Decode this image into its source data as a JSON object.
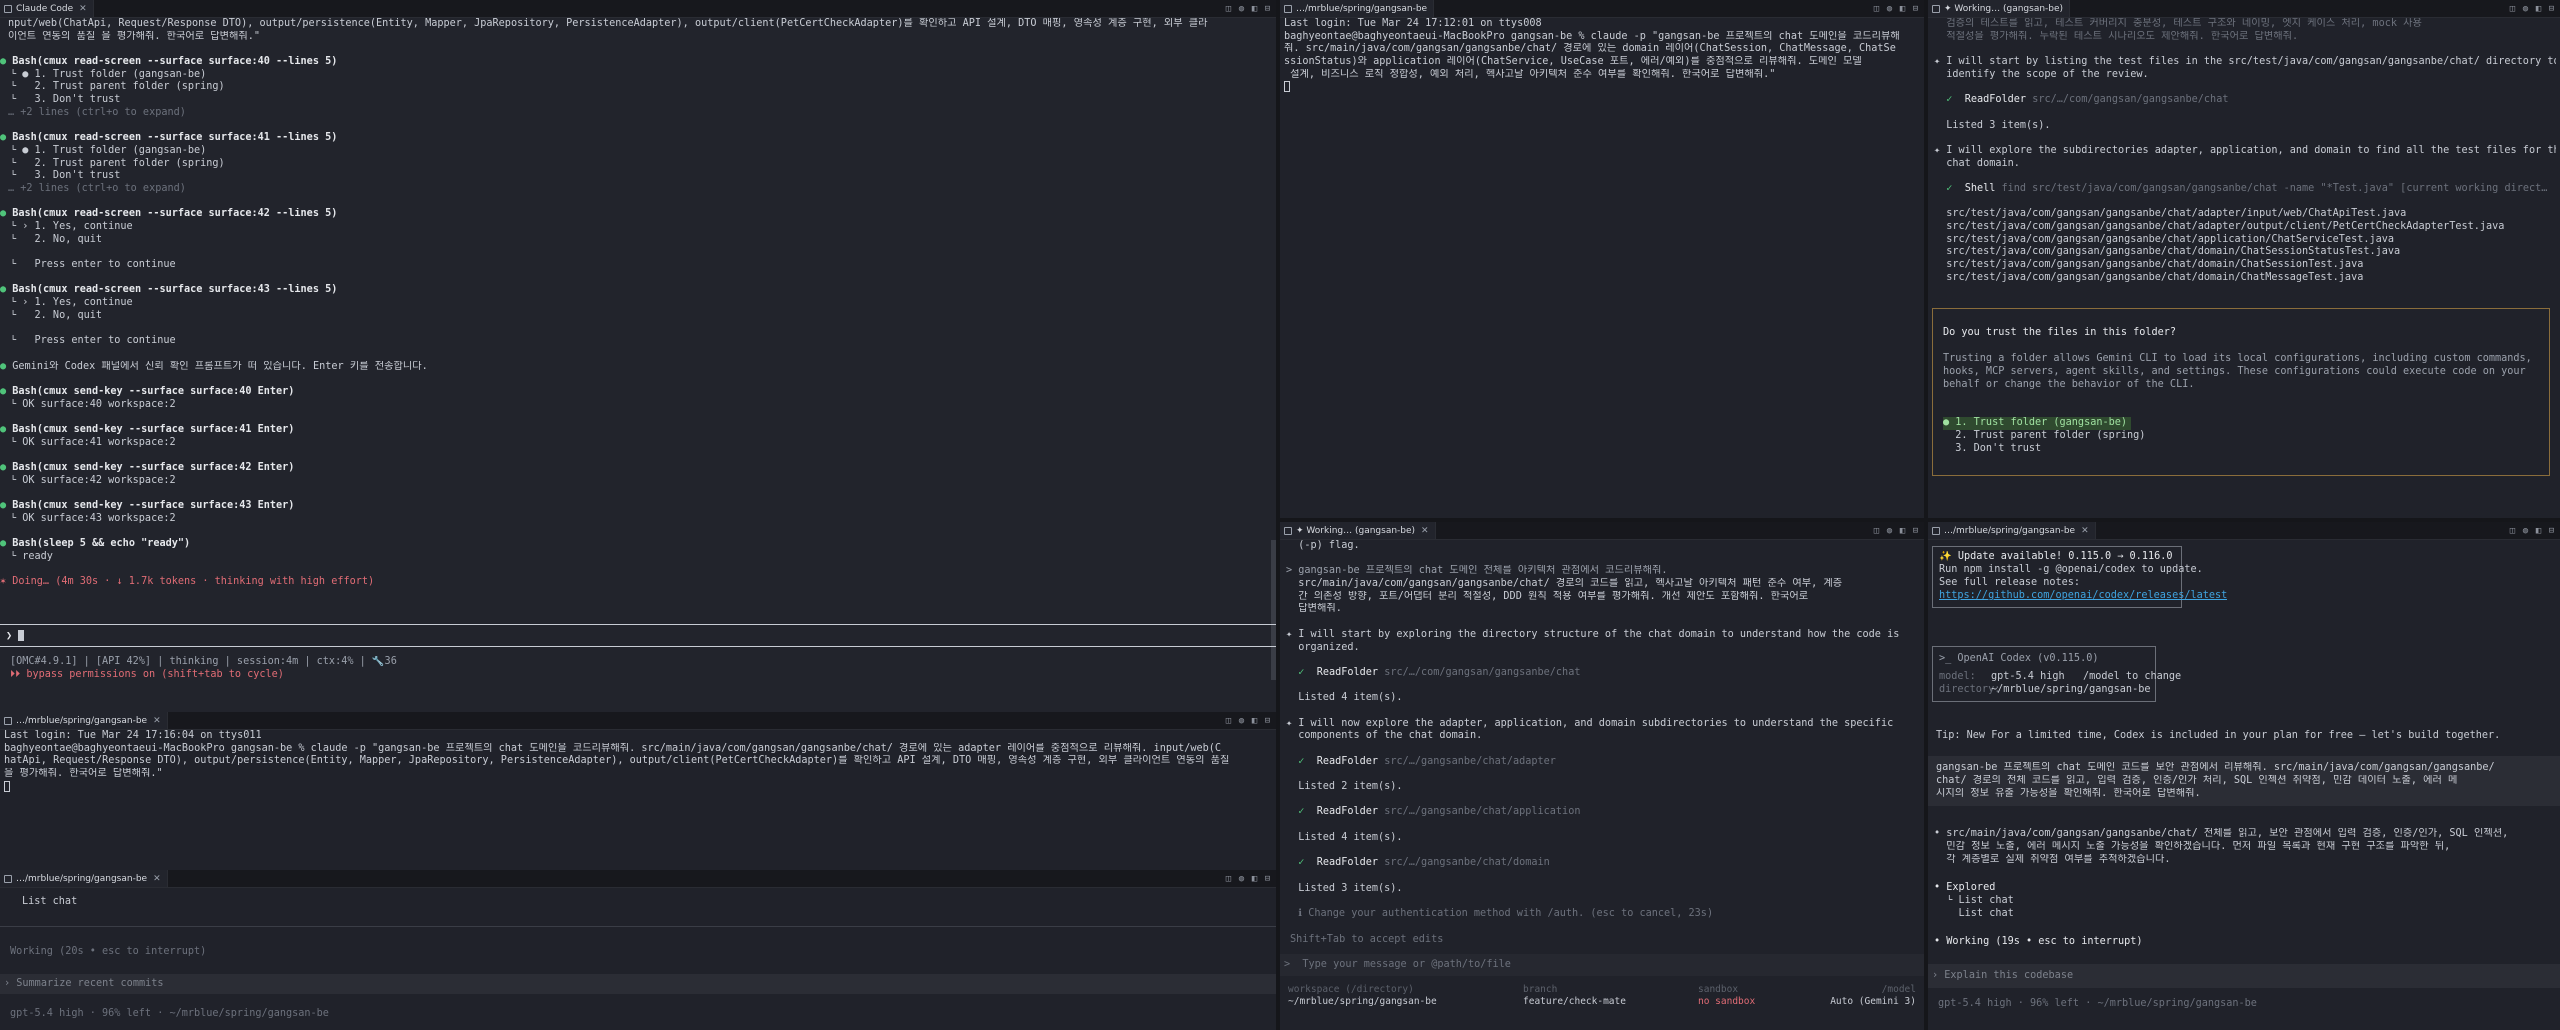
{
  "pane_tl": {
    "tab": "Claude Code",
    "lines": [
      "nput/web(ChatApi, Request/Response DTO), output/persistence(Entity, Mapper, JpaRepository, PersistenceAdapter), output/client(PetCertCheckAdapter)를 확인하고 API 설계, DTO 매핑, 영속성 계층 구현, 외부 클라",
      "이언트 연동의 품질 을 평가해줘. 한국어로 답변해줘.\"",
      "",
      "Bash(cmux read-screen --surface surface:40 --lines 5)",
      "  ● 1. Trust folder (gangsan-be)",
      "    2. Trust parent folder (spring)",
      "    3. Don't trust",
      "… +2 lines (ctrl+o to expand)",
      "",
      "Bash(cmux read-screen --surface surface:41 --lines 5)",
      "  ● 1. Trust folder (gangsan-be)",
      "    2. Trust parent folder (spring)",
      "    3. Don't trust",
      "… +2 lines (ctrl+o to expand)",
      "",
      "Bash(cmux read-screen --surface surface:42 --lines 5)",
      "  › 1. Yes, continue",
      "    2. No, quit",
      "",
      "    Press enter to continue",
      "",
      "Bash(cmux read-screen --surface surface:43 --lines 5)",
      "  › 1. Yes, continue",
      "    2. No, quit",
      "",
      "    Press enter to continue",
      "",
      "Gemini와 Codex 패널에서 신뢰 확인 프롬프트가 떠 있습니다. Enter 키를 전송합니다.",
      "",
      "Bash(cmux send-key --surface surface:40 Enter)",
      "  OK surface:40 workspace:2",
      "",
      "Bash(cmux send-key --surface surface:41 Enter)",
      "  OK surface:41 workspace:2",
      "",
      "Bash(cmux send-key --surface surface:42 Enter)",
      "  OK surface:42 workspace:2",
      "",
      "Bash(cmux send-key --surface surface:43 Enter)",
      "  OK surface:43 workspace:2",
      "",
      "Bash(sleep 5 && echo \"ready\")",
      "  ready",
      "",
      "✶ Doing… (4m 30s · ↓ 1.7k tokens · thinking with high effort)"
    ],
    "prompt": "❯",
    "status_line": "[OMC#4.9.1] | [API 42%] | thinking | session:4m | ctx:4% | 🔧36",
    "bypass_line": "⏵⏵ bypass permissions on (shift+tab to cycle)"
  },
  "pane_ml": {
    "tab": "…/mrblue/spring/gangsan-be",
    "lines": [
      "Last login: Tue Mar 24 17:16:04 on ttys011",
      "baghyeontae@baghyeontaeui-MacBookPro gangsan-be % claude -p \"gangsan-be 프로젝트의 chat 도메인을 코드리뷰해줘. src/main/java/com/gangsan/gangsanbe/chat/ 경로에 있는 adapter 레이어를 중점적으로 리뷰해줘. input/web(C",
      "hatApi, Request/Response DTO), output/persistence(Entity, Mapper, JpaRepository, PersistenceAdapter), output/client(PetCertCheckAdapter)를 확인하고 API 설계, DTO 매핑, 영속성 계층 구현, 외부 클라이언트 연동의 품질",
      "을 평가해줘. 한국어로 답변해줘.\""
    ]
  },
  "pane_bl": {
    "tab": "…/mrblue/spring/gangsan-be",
    "list_line": "List chat",
    "working": "Working (20s • esc to interrupt)",
    "input_placeholder": "Summarize recent commits",
    "footer": "gpt-5.4 high · 96% left · ~/mrblue/spring/gangsan-be"
  },
  "pane_tm": {
    "tab": "…/mrblue/spring/gangsan-be",
    "lines": [
      "Last login: Tue Mar 24 17:12:01 on ttys008",
      "baghyeontae@baghyeontaeui-MacBookPro gangsan-be % claude -p \"gangsan-be 프로젝트의 chat 도메인을 코드리뷰해",
      "줘. src/main/java/com/gangsan/gangsanbe/chat/ 경로에 있는 domain 레이어(ChatSession, ChatMessage, ChatSe",
      "ssionStatus)와 application 레이어(ChatService, UseCase 포트, 에러/예외)를 중점적으로 리뷰해줘. 도메인 모델",
      " 설계, 비즈니스 로직 정합성, 예외 처리, 헥사고날 아키텍처 준수 여부를 확인해줘. 한국어로 답변해줘.\""
    ]
  },
  "pane_bm": {
    "tab": "✦ Working… (gangsan-be)",
    "lines": [
      "  (-p) flag.",
      "",
      "> gangsan-be 프로젝트의 chat 도메인 전체를 아키텍처 관점에서 코드리뷰해줘.",
      "  src/main/java/com/gangsan/gangsanbe/chat/ 경로의 코드를 읽고, 헥사고날 아키텍처 패턴 준수 여부, 계층",
      "  간 의존성 방향, 포트/어댑터 분리 적절성, DDD 원칙 적용 여부를 평가해줘. 개선 제안도 포함해줘. 한국어로",
      "  답변해줘.",
      "",
      "✦ I will start by exploring the directory structure of the chat domain to understand how the code is",
      "  organized.",
      "",
      "  ✓  ReadFolder src/…/com/gangsan/gangsanbe/chat",
      "",
      "  Listed 4 item(s).",
      "",
      "✦ I will now explore the adapter, application, and domain subdirectories to understand the specific",
      "  components of the chat domain.",
      "",
      "  ✓  ReadFolder src/…/gangsanbe/chat/adapter",
      "",
      "  Listed 2 item(s).",
      "",
      "  ✓  ReadFolder src/…/gangsanbe/chat/application",
      "",
      "  Listed 4 item(s).",
      "",
      "  ✓  ReadFolder src/…/gangsanbe/chat/domain",
      "",
      "  Listed 3 item(s).",
      "",
      "  ℹ Change your authentication method with /auth. (esc to cancel, 23s)"
    ],
    "shift_hint": "Shift+Tab to accept edits",
    "input_placeholder": "  Type your message or @path/to/file",
    "footer_labels": [
      "workspace (/directory)",
      "branch",
      "sandbox",
      "/model"
    ],
    "footer_values": [
      "~/mrblue/spring/gangsan-be",
      "feature/check-mate",
      "no sandbox",
      "Auto (Gemini 3)"
    ]
  },
  "pane_tr": {
    "tab": "✦ Working… (gangsan-be)",
    "lines": [
      "  검증의 테스트를 읽고, 테스트 커버리지 충분성, 테스트 구조와 네이밍, 엣지 케이스 처리, mock 사용",
      "  적절성을 평가해줘. 누락된 테스트 시나리오도 제안해줘. 한국어로 답변해줘.",
      "",
      "✦ I will start by listing the test files in the src/test/java/com/gangsan/gangsanbe/chat/ directory to",
      "  identify the scope of the review.",
      "",
      "  ✓  ReadFolder src/…/com/gangsan/gangsanbe/chat",
      "",
      "  Listed 3 item(s).",
      "",
      "✦ I will explore the subdirectories adapter, application, and domain to find all the test files for the",
      "  chat domain.",
      "",
      "  ✓  Shell find src/test/java/com/gangsan/gangsanbe/chat -name \"*Test.java\" [current working direct…",
      "",
      "  src/test/java/com/gangsan/gangsanbe/chat/adapter/input/web/ChatApiTest.java",
      "  src/test/java/com/gangsan/gangsanbe/chat/adapter/output/client/PetCertCheckAdapterTest.java",
      "  src/test/java/com/gangsan/gangsanbe/chat/application/ChatServiceTest.java",
      "  src/test/java/com/gangsan/gangsanbe/chat/domain/ChatSessionStatusTest.java",
      "  src/test/java/com/gangsan/gangsanbe/chat/domain/ChatSessionTest.java",
      "  src/test/java/com/gangsan/gangsanbe/chat/domain/ChatMessageTest.java"
    ],
    "trust_title": "Do you trust the files in this folder?",
    "trust_body": [
      "Trusting a folder allows Gemini CLI to load its local configurations, including custom commands,",
      "hooks, MCP servers, agent skills, and settings. These configurations could execute code on your",
      "behalf or change the behavior of the CLI."
    ],
    "trust_options": [
      "● 1. Trust folder (gangsan-be)",
      "  2. Trust parent folder (spring)",
      "  3. Don't trust"
    ]
  },
  "pane_br": {
    "tab": "…/mrblue/spring/gangsan-be",
    "update_lines": [
      "✨ Update available! 0.115.0 → 0.116.0",
      "Run npm install -g @openai/codex to update.",
      "",
      "See full release notes:"
    ],
    "update_link": "https://github.com/openai/codex/releases/latest",
    "codex_title": ">_ OpenAI Codex (v0.115.0)",
    "codex_model_label": "model:",
    "codex_model": "gpt-5.4 high   /model to change",
    "codex_dir_label": "directory:",
    "codex_dir": "~/mrblue/spring/gangsan-be",
    "tip": "Tip: New For a limited time, Codex is included in your plan for free – let's build together.",
    "prompt_lines": [
      "gangsan-be 프로젝트의 chat 도메인 코드를 보안 관점에서 리뷰해줘. src/main/java/com/gangsan/gangsanbe/",
      "chat/ 경로의 전체 코드를 읽고, 입력 검증, 인증/인가 처리, SQL 인젝션 취약점, 민감 데이터 노출, 에러 메",
      "시지의 정보 유출 가능성을 확인해줘. 한국어로 답변해줘."
    ],
    "answer_lines": [
      "• src/main/java/com/gangsan/gangsanbe/chat/ 전체를 읽고, 보안 관점에서 입력 검증, 인증/인가, SQL 인젝션,",
      "  민감 정보 노출, 에러 메시지 노출 가능성을 확인하겠습니다. 먼저 파일 목록과 현재 구현 구조를 파악한 뒤,",
      "  각 계층별로 실제 취약점 여부를 추적하겠습니다."
    ],
    "explored_lines": [
      "• Explored",
      "  └ List chat",
      "    List chat"
    ],
    "working": "• Working (19s • esc to interrupt)",
    "input_placeholder": "Explain this codebase",
    "footer": "gpt-5.4 high · 96% left · ~/mrblue/spring/gangsan-be"
  }
}
